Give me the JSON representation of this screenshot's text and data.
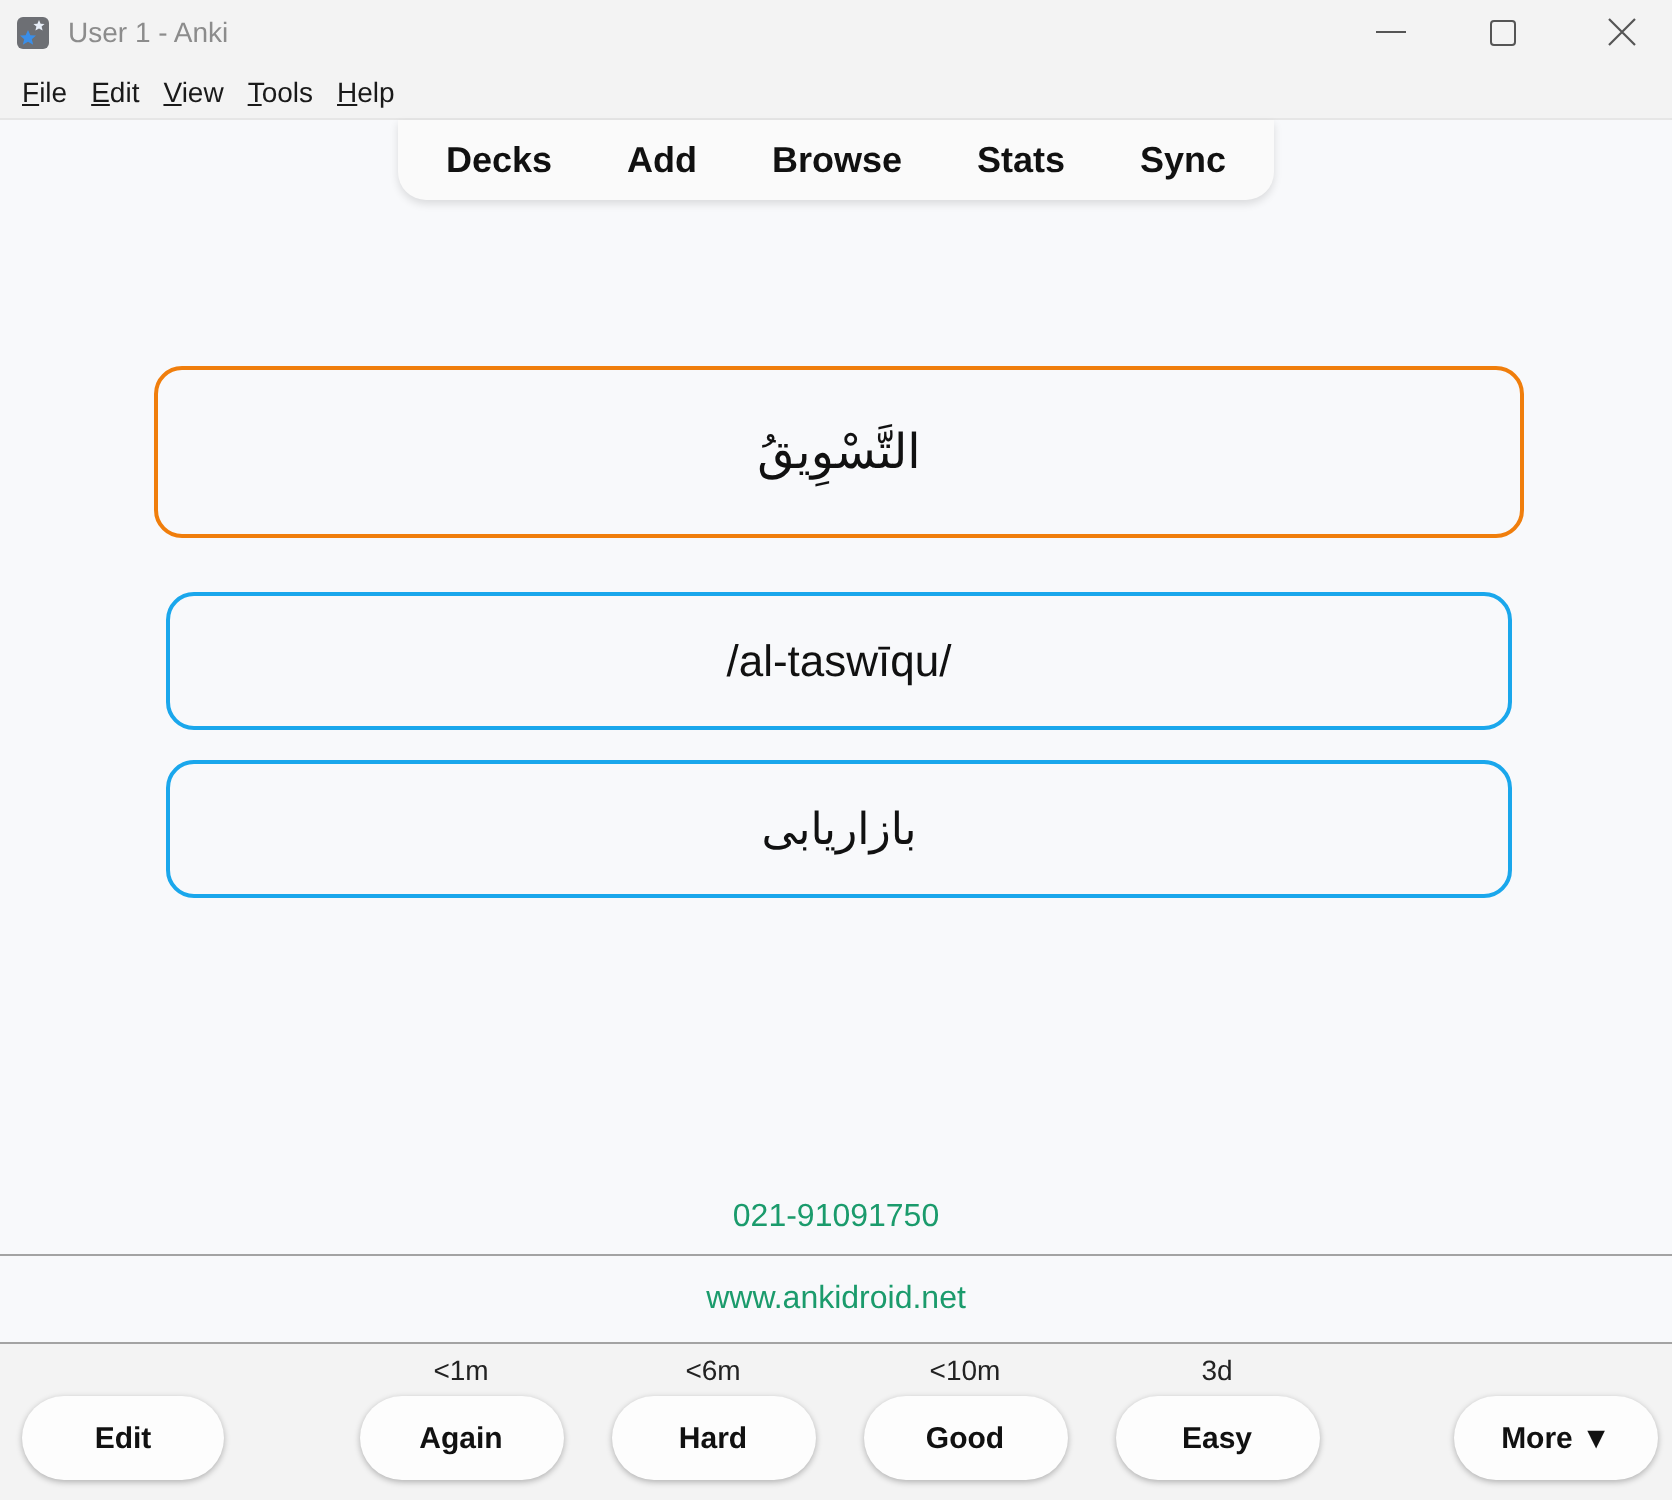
{
  "window": {
    "title": "User 1 - Anki"
  },
  "menu": [
    "File",
    "Edit",
    "View",
    "Tools",
    "Help"
  ],
  "toolbar": [
    "Decks",
    "Add",
    "Browse",
    "Stats",
    "Sync"
  ],
  "cards": [
    {
      "kind": "front",
      "text": "التَّسْوِيقُ",
      "color": "#f07e0c"
    },
    {
      "kind": "back",
      "text": "/al-taswīqu/",
      "color": "#1aa7ec"
    },
    {
      "kind": "back",
      "text": "بازاریابی",
      "color": "#1aa7ec"
    }
  ],
  "footer": {
    "phone": "021-91091750",
    "website": "www.ankidroid.net"
  },
  "edit_button": "Edit",
  "answer_buttons": [
    {
      "label": "Again",
      "interval": "<1m"
    },
    {
      "label": "Hard",
      "interval": "<6m"
    },
    {
      "label": "Good",
      "interval": "<10m"
    },
    {
      "label": "Easy",
      "interval": "3d"
    }
  ],
  "more_button": "More ▼"
}
